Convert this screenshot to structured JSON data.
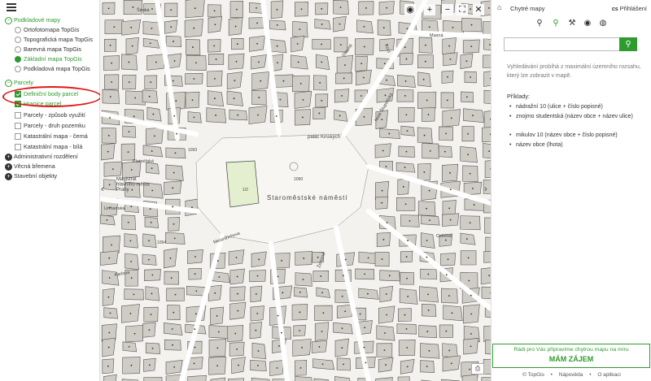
{
  "left_panel": {
    "groups": [
      {
        "label": "Podkladové mapy",
        "expanded": true
      },
      {
        "label": "Parcely",
        "expanded": true
      },
      {
        "label": "Administrativní rozdělení",
        "expanded": false
      },
      {
        "label": "Věcná břemena",
        "expanded": false
      },
      {
        "label": "Stavební objekty",
        "expanded": false
      }
    ],
    "basemaps": [
      {
        "label": "Ortofotomapa TopGis",
        "selected": false
      },
      {
        "label": "Topografická mapa TopGis",
        "selected": false
      },
      {
        "label": "Barevná mapa TopGis",
        "selected": false
      },
      {
        "label": "Základní mapa TopGis",
        "selected": true
      },
      {
        "label": "Podkladová mapa TopGis",
        "selected": false
      }
    ],
    "parcel_layers": [
      {
        "label": "Definiční body parcel",
        "checked": true
      },
      {
        "label": "Hranice parcel",
        "checked": true
      },
      {
        "label": "Parcely - způsob využití",
        "checked": false
      },
      {
        "label": "Parcely - druh pozemku",
        "checked": false
      },
      {
        "label": "Katastrální mapa - černá",
        "checked": false
      },
      {
        "label": "Katastrální mapa - bílá",
        "checked": false
      }
    ]
  },
  "map": {
    "labels": {
      "square": "Staroměstské náměstí",
      "palace": "palác Kinských",
      "magistrat": "Magistrát\nhlavního města\nPrahy",
      "platnerska": "Platnéřská",
      "linhartska": "Linhartská",
      "masna": "Masná",
      "dlouha": "Dlouhá",
      "celetna": "Celetná",
      "melantrichova": "Melantrichova",
      "karlova": "Karlova",
      "zelezna": "Železná",
      "kozi": "Kozí",
      "parcel_1090": "1090",
      "parcel_1_2": "1/2",
      "parcel_1093": "1093",
      "parcel_1094": "1094",
      "street_siroka": "Široká",
      "street_mala_stupartska": "Malá Štupartská"
    },
    "colors": {
      "background": "#f4f2ee",
      "building": "#cfccc6",
      "park": "#e3efce",
      "street_white": "#ffffff"
    }
  },
  "right_panel": {
    "app_name": "Chytré mapy",
    "login_code": "cs",
    "login_label": "Přihlášení",
    "tools": [
      "location-pin-icon",
      "search-icon",
      "measure-icon",
      "eye-icon",
      "globe-icon"
    ],
    "search_placeholder": "",
    "search_info": "Vyhledávání probíhá z maximální územního rozsahu, který lze zobrazit v mapě.",
    "examples_title": "Příklady:",
    "examples": [
      "nádražní 10 (ulice + číslo popisné)",
      "znojmo studentská (název obce + název ulice)",
      "mikulov 10 (název obce + číslo popisné)",
      "název obce (lhota)"
    ],
    "promo_text": "Rádi pro Vás připravíme chytrou mapu na míru",
    "promo_button": "MÁM ZÁJEM",
    "footer": [
      "© TopGis",
      "•",
      "Nápověda",
      "•",
      "O aplikaci"
    ]
  }
}
